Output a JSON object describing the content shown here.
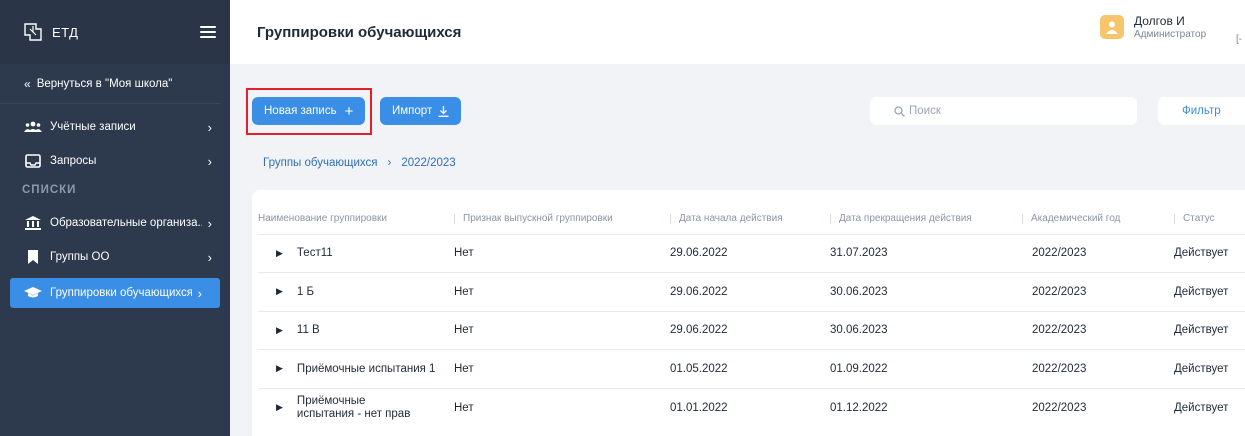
{
  "sidebar": {
    "app_name": "ЕТД",
    "back_label": "Вернуться в \"Моя школа\"",
    "items": [
      {
        "label": "Учётные записи"
      },
      {
        "label": "Запросы"
      }
    ],
    "section_label": "СПИСКИ",
    "list_items": [
      {
        "label": "Образовательные организа..."
      },
      {
        "label": "Группы ОО"
      },
      {
        "label": "Группировки обучающихся"
      }
    ]
  },
  "header": {
    "title": "Группировки обучающихся",
    "user_name": "Долгов И",
    "user_role": "Администратор",
    "user_extra": "[-"
  },
  "toolbar": {
    "new_record_label": "Новая запись",
    "import_label": "Импорт",
    "search_placeholder": "Поиск",
    "filter_label": "Фильтр"
  },
  "breadcrumb": {
    "items": [
      "Группы обучающихся",
      "2022/2023"
    ]
  },
  "table": {
    "columns": [
      "Наименование группировки",
      "Признак выпускной группировки",
      "Дата начала действия",
      "Дата прекращения действия",
      "Академический год",
      "Статус"
    ],
    "rows": [
      {
        "name": "Тест11",
        "graduate": "Нет",
        "start": "29.06.2022",
        "end": "31.07.2023",
        "year": "2022/2023",
        "status": "Действует"
      },
      {
        "name": "1 Б",
        "graduate": "Нет",
        "start": "29.06.2022",
        "end": "30.06.2023",
        "year": "2022/2023",
        "status": "Действует"
      },
      {
        "name": "11 В",
        "graduate": "Нет",
        "start": "29.06.2022",
        "end": "30.06.2023",
        "year": "2022/2023",
        "status": "Действует"
      },
      {
        "name": "Приёмочные испытания 1",
        "graduate": "Нет",
        "start": "01.05.2022",
        "end": "01.09.2022",
        "year": "2022/2023",
        "status": "Действует"
      },
      {
        "name": "Приёмочные испытания - нет прав",
        "graduate": "Нет",
        "start": "01.01.2022",
        "end": "01.12.2022",
        "year": "2022/2023",
        "status": "Действует"
      }
    ]
  },
  "colors": {
    "sidebar_bg": "#2d3a4d",
    "accent": "#3a8ee6",
    "highlight": "#e0212a"
  }
}
